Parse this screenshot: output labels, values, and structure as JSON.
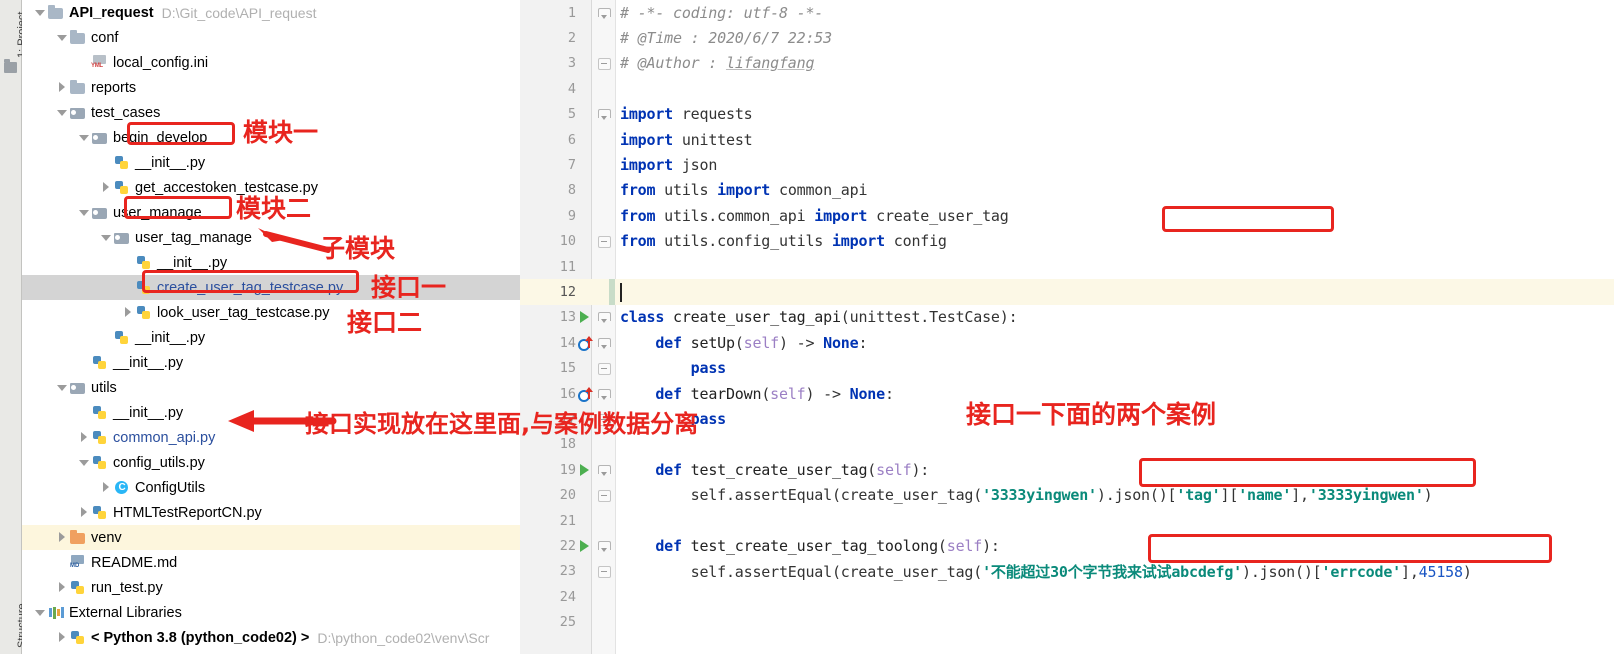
{
  "rail": {
    "project_label": "1: Project",
    "structure_label": "Structure"
  },
  "tree": [
    {
      "indent": 0,
      "arrow": "down",
      "icon": "folder",
      "label": "API_request",
      "bold": true,
      "path": "D:\\Git_code\\API_request"
    },
    {
      "indent": 1,
      "arrow": "down",
      "icon": "folder",
      "label": "conf",
      "bold": false,
      "path": ""
    },
    {
      "indent": 2,
      "arrow": "none",
      "icon": "ini",
      "label": "local_config.ini",
      "bold": false,
      "path": ""
    },
    {
      "indent": 1,
      "arrow": "right",
      "icon": "folder",
      "label": "reports",
      "bold": false,
      "path": ""
    },
    {
      "indent": 1,
      "arrow": "down",
      "icon": "pkg",
      "label": "test_cases",
      "bold": false,
      "path": ""
    },
    {
      "indent": 2,
      "arrow": "down",
      "icon": "pkg",
      "label": "begin_develop",
      "bold": false,
      "path": ""
    },
    {
      "indent": 3,
      "arrow": "none",
      "icon": "py",
      "label": "__init__.py",
      "bold": false,
      "path": ""
    },
    {
      "indent": 3,
      "arrow": "right",
      "icon": "py",
      "label": "get_accestoken_testcase.py",
      "bold": false,
      "path": ""
    },
    {
      "indent": 2,
      "arrow": "down",
      "icon": "pkg",
      "label": "user_manage",
      "bold": false,
      "path": ""
    },
    {
      "indent": 3,
      "arrow": "down",
      "icon": "pkg",
      "label": "user_tag_manage",
      "bold": false,
      "path": ""
    },
    {
      "indent": 4,
      "arrow": "none",
      "icon": "py",
      "label": "__init__.py",
      "bold": false,
      "path": ""
    },
    {
      "indent": 4,
      "arrow": "none",
      "icon": "py",
      "label": "create_user_tag_testcase.py",
      "bold": false,
      "path": "",
      "selected": true,
      "blue": true
    },
    {
      "indent": 4,
      "arrow": "right",
      "icon": "py",
      "label": "look_user_tag_testcase.py",
      "bold": false,
      "path": ""
    },
    {
      "indent": 3,
      "arrow": "none",
      "icon": "py",
      "label": "__init__.py",
      "bold": false,
      "path": ""
    },
    {
      "indent": 2,
      "arrow": "none",
      "icon": "py",
      "label": "__init__.py",
      "bold": false,
      "path": ""
    },
    {
      "indent": 1,
      "arrow": "down",
      "icon": "pkg",
      "label": "utils",
      "bold": false,
      "path": ""
    },
    {
      "indent": 2,
      "arrow": "none",
      "icon": "py",
      "label": "__init__.py",
      "bold": false,
      "path": ""
    },
    {
      "indent": 2,
      "arrow": "right",
      "icon": "py",
      "label": "common_api.py",
      "bold": false,
      "path": "",
      "blue": true
    },
    {
      "indent": 2,
      "arrow": "down",
      "icon": "py",
      "label": "config_utils.py",
      "bold": false,
      "path": ""
    },
    {
      "indent": 3,
      "arrow": "right",
      "icon": "cls",
      "label": "ConfigUtils",
      "bold": false,
      "path": ""
    },
    {
      "indent": 2,
      "arrow": "right",
      "icon": "py",
      "label": "HTMLTestReportCN.py",
      "bold": false,
      "path": ""
    },
    {
      "indent": 1,
      "arrow": "right",
      "icon": "folder-orange",
      "label": "venv",
      "bold": false,
      "path": "",
      "highlight": true
    },
    {
      "indent": 1,
      "arrow": "none",
      "icon": "md",
      "label": "README.md",
      "bold": false,
      "path": ""
    },
    {
      "indent": 1,
      "arrow": "right",
      "icon": "py",
      "label": "run_test.py",
      "bold": false,
      "path": ""
    },
    {
      "indent": 0,
      "arrow": "down",
      "icon": "libs",
      "label": "External Libraries",
      "bold": false,
      "path": ""
    },
    {
      "indent": 1,
      "arrow": "right",
      "icon": "py",
      "label": "< Python 3.8 (python_code02) >",
      "bold": true,
      "path": "D:\\python_code02\\venv\\Scr"
    }
  ],
  "editor": {
    "lines": [
      {
        "n": "1",
        "gutter": "",
        "fold": "open",
        "tokens": [
          {
            "t": "cmt",
            "v": "# -*- coding: utf-8 -*-"
          }
        ]
      },
      {
        "n": "2",
        "gutter": "",
        "fold": "",
        "tokens": [
          {
            "t": "cmt",
            "v": "# @Time : 2020/6/7 22:53"
          }
        ]
      },
      {
        "n": "3",
        "gutter": "",
        "fold": "tick",
        "tokens": [
          {
            "t": "cmt",
            "v": "# @Author : "
          },
          {
            "t": "cmtu",
            "v": "lifangfang"
          }
        ]
      },
      {
        "n": "4",
        "gutter": "",
        "fold": "",
        "tokens": []
      },
      {
        "n": "5",
        "gutter": "",
        "fold": "open",
        "tokens": [
          {
            "t": "kw",
            "v": "import "
          },
          {
            "t": "plain",
            "v": "requests"
          }
        ]
      },
      {
        "n": "6",
        "gutter": "",
        "fold": "",
        "tokens": [
          {
            "t": "kw",
            "v": "import "
          },
          {
            "t": "plain",
            "v": "unittest"
          }
        ]
      },
      {
        "n": "7",
        "gutter": "",
        "fold": "",
        "tokens": [
          {
            "t": "kw",
            "v": "import "
          },
          {
            "t": "plain",
            "v": "json"
          }
        ]
      },
      {
        "n": "8",
        "gutter": "",
        "fold": "",
        "tokens": [
          {
            "t": "kw",
            "v": "from "
          },
          {
            "t": "plain",
            "v": "utils "
          },
          {
            "t": "kw",
            "v": "import "
          },
          {
            "t": "plain",
            "v": "common_api"
          }
        ]
      },
      {
        "n": "9",
        "gutter": "",
        "fold": "",
        "tokens": [
          {
            "t": "kw",
            "v": "from "
          },
          {
            "t": "plain",
            "v": "utils.common_api "
          },
          {
            "t": "kw",
            "v": "import "
          },
          {
            "t": "plain",
            "v": "create_user_tag"
          }
        ]
      },
      {
        "n": "10",
        "gutter": "",
        "fold": "tick",
        "tokens": [
          {
            "t": "kw",
            "v": "from "
          },
          {
            "t": "plain",
            "v": "utils.config_utils "
          },
          {
            "t": "kw",
            "v": "import "
          },
          {
            "t": "plain",
            "v": "config"
          }
        ]
      },
      {
        "n": "11",
        "gutter": "",
        "fold": "",
        "tokens": []
      },
      {
        "n": "12",
        "gutter": "",
        "fold": "",
        "tokens": [],
        "current": true
      },
      {
        "n": "13",
        "gutter": "run",
        "fold": "open",
        "tokens": [
          {
            "t": "kw",
            "v": "class "
          },
          {
            "t": "fname",
            "v": "create_user_tag_api"
          },
          {
            "t": "plain",
            "v": "(unittest.TestCase):"
          }
        ]
      },
      {
        "n": "14",
        "gutter": "ovr",
        "fold": "open",
        "tokens": [
          {
            "t": "plain",
            "v": "    "
          },
          {
            "t": "kw",
            "v": "def "
          },
          {
            "t": "fname",
            "v": "setUp"
          },
          {
            "t": "plain",
            "v": "("
          },
          {
            "t": "selfkw",
            "v": "self"
          },
          {
            "t": "plain",
            "v": ") -> "
          },
          {
            "t": "kw",
            "v": "None"
          },
          {
            "t": "plain",
            "v": ":"
          }
        ]
      },
      {
        "n": "15",
        "gutter": "",
        "fold": "tick",
        "tokens": [
          {
            "t": "plain",
            "v": "        "
          },
          {
            "t": "kw",
            "v": "pass"
          }
        ]
      },
      {
        "n": "16",
        "gutter": "ovr",
        "fold": "open",
        "tokens": [
          {
            "t": "plain",
            "v": "    "
          },
          {
            "t": "kw",
            "v": "def "
          },
          {
            "t": "fname",
            "v": "tearDown"
          },
          {
            "t": "plain",
            "v": "("
          },
          {
            "t": "selfkw",
            "v": "self"
          },
          {
            "t": "plain",
            "v": ") -> "
          },
          {
            "t": "kw",
            "v": "None"
          },
          {
            "t": "plain",
            "v": ":"
          }
        ]
      },
      {
        "n": "17",
        "gutter": "",
        "fold": "tick",
        "tokens": [
          {
            "t": "plain",
            "v": "        "
          },
          {
            "t": "kw",
            "v": "pass"
          }
        ]
      },
      {
        "n": "18",
        "gutter": "",
        "fold": "",
        "tokens": []
      },
      {
        "n": "19",
        "gutter": "run",
        "fold": "open",
        "tokens": [
          {
            "t": "plain",
            "v": "    "
          },
          {
            "t": "kw",
            "v": "def "
          },
          {
            "t": "fname",
            "v": "test_create_user_tag"
          },
          {
            "t": "plain",
            "v": "("
          },
          {
            "t": "selfkw",
            "v": "self"
          },
          {
            "t": "plain",
            "v": "):"
          }
        ]
      },
      {
        "n": "20",
        "gutter": "",
        "fold": "tick",
        "tokens": [
          {
            "t": "plain",
            "v": "        self.assertEqual(create_user_tag("
          },
          {
            "t": "str",
            "v": "'3333yingwen'"
          },
          {
            "t": "plain",
            "v": ").json()["
          },
          {
            "t": "str",
            "v": "'tag'"
          },
          {
            "t": "plain",
            "v": "]["
          },
          {
            "t": "str",
            "v": "'name'"
          },
          {
            "t": "plain",
            "v": "],"
          },
          {
            "t": "str",
            "v": "'3333yingwen'"
          },
          {
            "t": "plain",
            "v": ")"
          }
        ]
      },
      {
        "n": "21",
        "gutter": "",
        "fold": "",
        "tokens": []
      },
      {
        "n": "22",
        "gutter": "run",
        "fold": "open",
        "tokens": [
          {
            "t": "plain",
            "v": "    "
          },
          {
            "t": "kw",
            "v": "def "
          },
          {
            "t": "fname",
            "v": "test_create_user_tag_toolong"
          },
          {
            "t": "plain",
            "v": "("
          },
          {
            "t": "selfkw",
            "v": "self"
          },
          {
            "t": "plain",
            "v": "):"
          }
        ]
      },
      {
        "n": "23",
        "gutter": "",
        "fold": "tick",
        "tokens": [
          {
            "t": "plain",
            "v": "        self.assertEqual(create_user_tag("
          },
          {
            "t": "str",
            "v": "'不能超过30个字节我来试试abcdefg'"
          },
          {
            "t": "plain",
            "v": ").json()["
          },
          {
            "t": "str",
            "v": "'errcode'"
          },
          {
            "t": "plain",
            "v": "],"
          },
          {
            "t": "num",
            "v": "45158"
          },
          {
            "t": "plain",
            "v": ")"
          }
        ]
      },
      {
        "n": "24",
        "gutter": "",
        "fold": "",
        "tokens": []
      },
      {
        "n": "25",
        "gutter": "",
        "fold": "",
        "tokens": []
      }
    ]
  },
  "annotations": [
    {
      "id": "module-one",
      "text": "模块一"
    },
    {
      "id": "module-two",
      "text": "模块二"
    },
    {
      "id": "sub-module",
      "text": "子模块"
    },
    {
      "id": "interface-one",
      "text": "接口一"
    },
    {
      "id": "interface-two",
      "text": "接口二"
    },
    {
      "id": "impl-here",
      "text": "接口实现放在这里面,与案例数据分离"
    },
    {
      "id": "two-cases",
      "text": "接口一下面的两个案例"
    }
  ],
  "colors": {
    "annotation_red": "#e8251f",
    "selection_grey": "#d4d4d4",
    "highlight_yellow": "#fdf6dd",
    "keyword_blue": "#0033b3",
    "string_teal": "#0a8a7a"
  }
}
